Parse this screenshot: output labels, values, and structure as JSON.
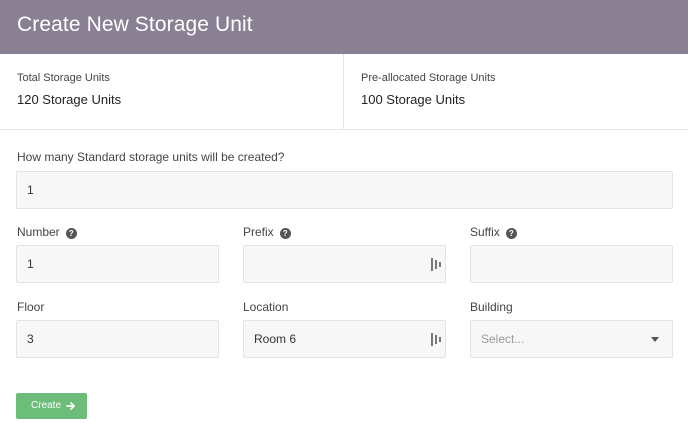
{
  "header": {
    "title": "Create New Storage Unit"
  },
  "stats": {
    "total_label": "Total Storage Units",
    "total_value": "120 Storage Units",
    "preallocated_label": "Pre-allocated Storage Units",
    "preallocated_value": "100 Storage Units"
  },
  "form": {
    "question": "How many Standard storage units will be created?",
    "count_value": "1",
    "number": {
      "label": "Number",
      "value": "1"
    },
    "prefix": {
      "label": "Prefix",
      "value": ""
    },
    "suffix": {
      "label": "Suffix",
      "value": ""
    },
    "floor": {
      "label": "Floor",
      "value": "3"
    },
    "location": {
      "label": "Location",
      "value": "Room 6"
    },
    "building": {
      "label": "Building",
      "placeholder": "Select..."
    },
    "help_glyph": "?"
  },
  "actions": {
    "create_label": "Create"
  },
  "colors": {
    "header_bg": "#8a8093",
    "button_bg": "#6cbd7a"
  },
  "icons": [
    "help-icon",
    "input-extension-icon",
    "chevron-down-icon",
    "arrow-right-icon"
  ]
}
